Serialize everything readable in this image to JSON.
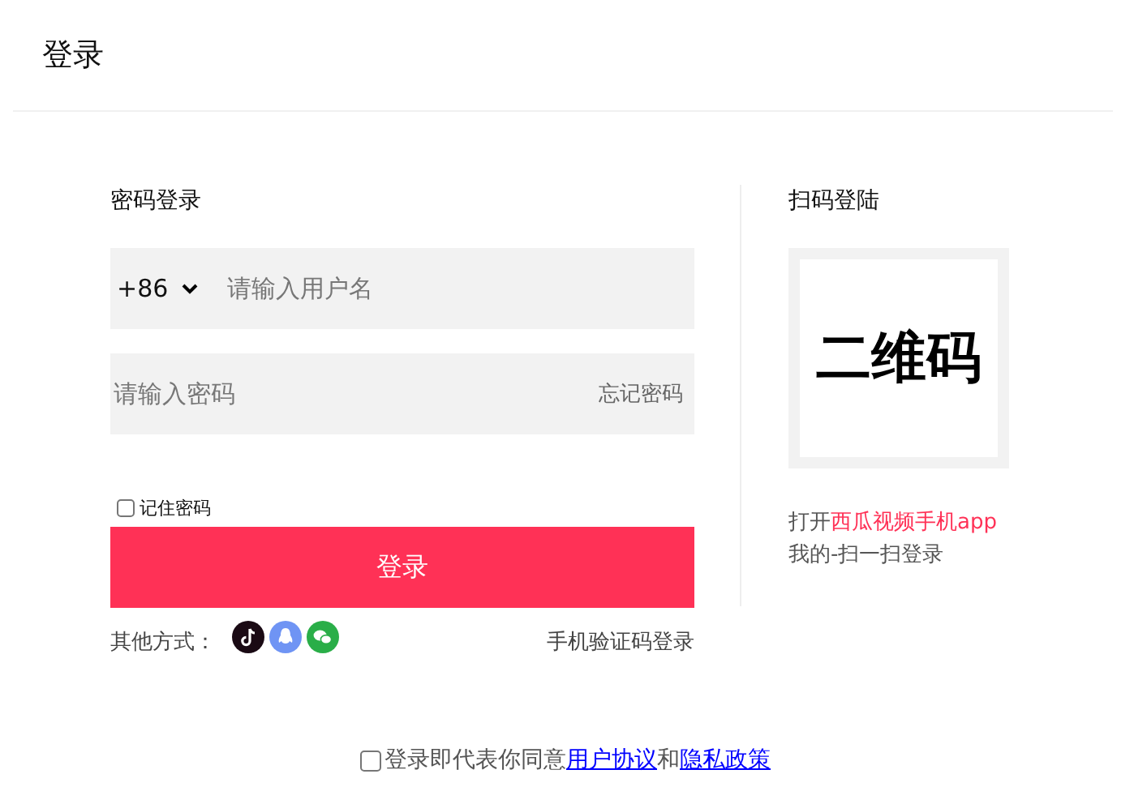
{
  "header": {
    "title": "登录"
  },
  "password_login": {
    "title": "密码登录",
    "country_code": "+86",
    "username": {
      "placeholder": "请输入用户名"
    },
    "password": {
      "placeholder": "请输入密码"
    },
    "forgot": "忘记密码",
    "remember": {
      "label": "记住密码",
      "checked": false
    },
    "submit": "登录",
    "other_label": "其他方式：",
    "other_methods": [
      {
        "kind": "tiktok",
        "color": "#1a0a14"
      },
      {
        "kind": "qq",
        "color": "#6f94f4"
      },
      {
        "kind": "wechat",
        "color": "#2aae48"
      }
    ],
    "sms_login": "手机验证码登录"
  },
  "qr_login": {
    "title": "扫码登陆",
    "qr_text": "二维码",
    "hint_prefix": "打开",
    "hint_link": "西瓜视频手机app",
    "hint_line2": "我的-扫一扫登录"
  },
  "agreement": {
    "checked": false,
    "text": "登录即代表你同意",
    "link1": "用户协议",
    "joiner": "和",
    "link2": "隐私政策"
  }
}
